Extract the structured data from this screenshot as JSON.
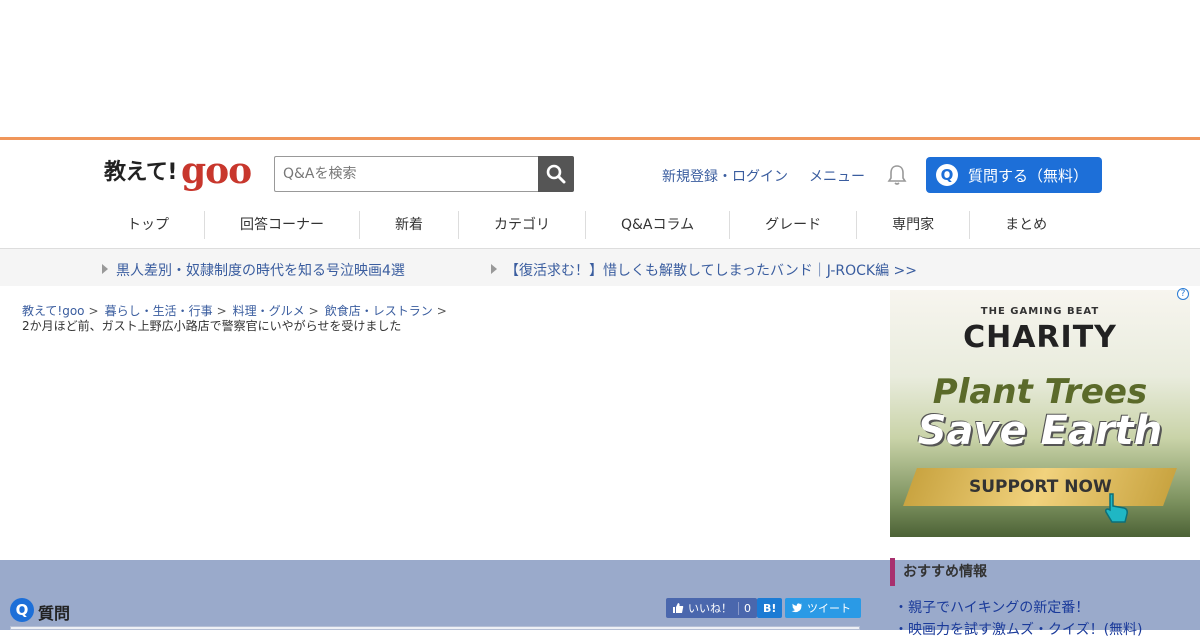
{
  "header": {
    "logo_jp": "教えて!",
    "logo_goo": "goo",
    "search_placeholder": "Q&Aを検索",
    "register_login": "新規登録・ログイン",
    "menu": "メニュー",
    "ask_button": "質問する（無料）",
    "ask_icon": "Q"
  },
  "nav": {
    "items": [
      "トップ",
      "回答コーナー",
      "新着",
      "カテゴリ",
      "Q&Aコラム",
      "グレード",
      "専門家",
      "まとめ"
    ]
  },
  "promo": {
    "link1": "黒人差別・奴隷制度の時代を知る号泣映画4選",
    "link2": "【復活求む！】惜しくも解散してしまったバンド｜J-ROCK編 >>"
  },
  "breadcrumb": {
    "items": [
      "教えて!goo",
      "暮らし・生活・行事",
      "料理・グルメ",
      "飲食店・レストラン"
    ],
    "separator": ">",
    "current": "2か月ほど前、ガスト上野広小路店で警察官にいやがらせを受けました"
  },
  "ad": {
    "line1": "THE GAMING BEAT",
    "line2": "CHARITY",
    "line3": "Plant Trees",
    "line4": "Save Earth",
    "button": "SUPPORT NOW",
    "adchoice": "?"
  },
  "question": {
    "icon": "Q",
    "title": "質問",
    "like_label": "いいね！",
    "like_count": "0",
    "hatena": "B!",
    "tweet": "ツイート"
  },
  "sidebar": {
    "heading": "おすすめ情報",
    "links": [
      "・親子でハイキングの新定番！",
      "・映画力を試す激ムズ・クイズ！(無料)"
    ]
  }
}
